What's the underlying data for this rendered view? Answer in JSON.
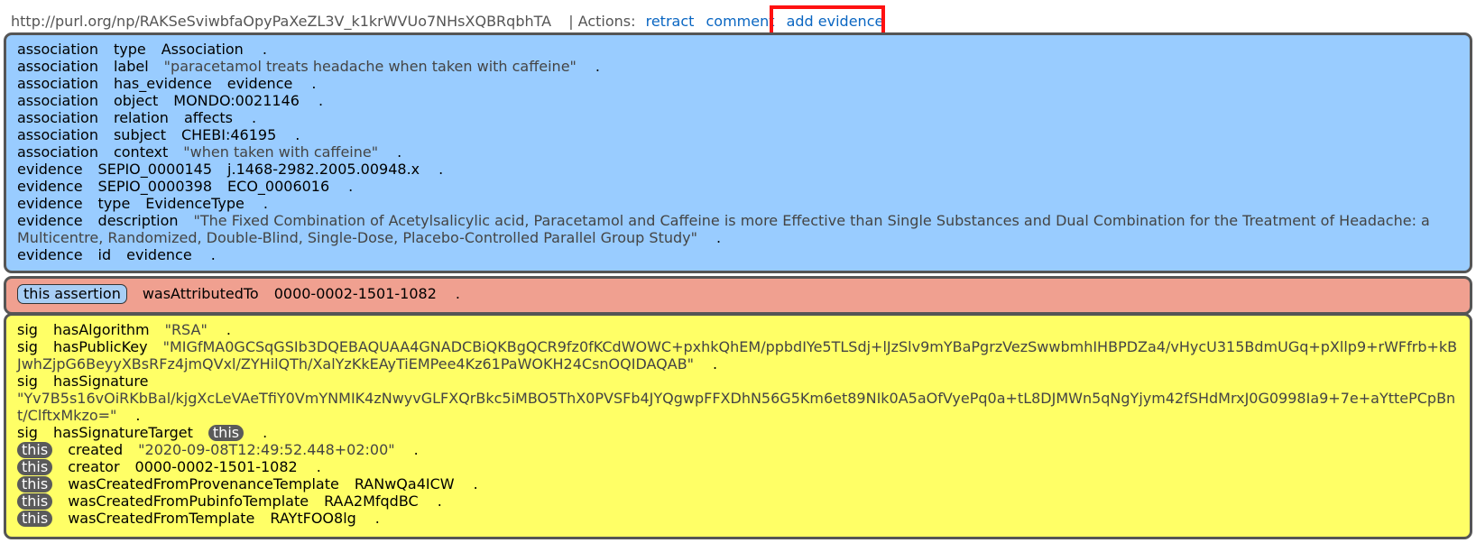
{
  "header": {
    "uri": "http://purl.org/np/RAKSeSviwbfaOpyPaXeZL3V_k1krWVUo7NHsXQBRqbhTA",
    "actions_label": "| Actions:",
    "actions": [
      "retract",
      "comment",
      "add evidence"
    ]
  },
  "highlight_color": "#ff1111",
  "colors": {
    "assertion_bg": "#99ccff",
    "provenance_bg": "#f0a090",
    "pubinfo_bg": "#ffff66",
    "link": "#0a66c2"
  },
  "dot": ".",
  "assertion": [
    {
      "s": "association",
      "p": "type",
      "o": "Association"
    },
    {
      "s": "association",
      "p": "label",
      "o": "\"paracetamol treats headache when taken with caffeine\""
    },
    {
      "s": "association",
      "p": "has_evidence",
      "o": "evidence"
    },
    {
      "s": "association",
      "p": "object",
      "o": "MONDO:0021146"
    },
    {
      "s": "association",
      "p": "relation",
      "o": "affects"
    },
    {
      "s": "association",
      "p": "subject",
      "o": "CHEBI:46195"
    },
    {
      "s": "association",
      "p": "context",
      "o": "\"when taken with caffeine\""
    },
    {
      "s": "evidence",
      "p": "SEPIO_0000145",
      "o": "j.1468-2982.2005.00948.x"
    },
    {
      "s": "evidence",
      "p": "SEPIO_0000398",
      "o": "ECO_0006016"
    },
    {
      "s": "evidence",
      "p": "type",
      "o": "EvidenceType"
    },
    {
      "s": "evidence",
      "p": "description",
      "o": "\"The Fixed Combination of Acetylsalicylic acid, Paracetamol and Caffeine is more Effective than Single Substances and Dual Combination for the Treatment of Headache: a Multicentre, Randomized, Double-Blind, Single-Dose, Placebo-Controlled Parallel Group Study\""
    },
    {
      "s": "evidence",
      "p": "id",
      "o": "evidence"
    }
  ],
  "provenance": {
    "s": "this assertion",
    "p": "wasAttributedTo",
    "o": "0000-0002-1501-1082"
  },
  "pubinfo": {
    "sig_alg": {
      "s": "sig",
      "p": "hasAlgorithm",
      "o": "\"RSA\""
    },
    "sig_key": {
      "s": "sig",
      "p": "hasPublicKey",
      "o": "\"MIGfMA0GCSqGSIb3DQEBAQUAA4GNADCBiQKBgQCR9fz0fKCdWOWC+pxhkQhEM/ppbdIYe5TLSdj+lJzSlv9mYBaPgrzVezSwwbmhIHBPDZa4/vHycU315BdmUGq+pXllp9+rWFfrb+kBJwhZjpG6BeyyXBsRFz4jmQVxl/ZYHilQTh/XalYzKkEAyTiEMPee4Kz61PaWOKH24CsnOQIDAQAB\""
    },
    "sig_signature": {
      "s": "sig",
      "p": "hasSignature",
      "o": "\"Yv7B5s16vOiRKbBal/kjgXcLeVAeTfiY0VmYNMIK4zNwyvGLFXQrBkc5iMBO5ThX0PVSFb4JYQgwpFFXDhN56G5Km6et89NIk0A5aOfVyePq0a+tL8DJMWn5qNgYjym42fSHdMrxJ0G0998Ia9+7e+aYttePCpBnt/ClftxMkzo=\""
    },
    "sig_target": {
      "s": "sig",
      "p": "hasSignatureTarget",
      "o": "this"
    },
    "this_triples": [
      {
        "s": "this",
        "p": "created",
        "o": "\"2020-09-08T12:49:52.448+02:00\""
      },
      {
        "s": "this",
        "p": "creator",
        "o": "0000-0002-1501-1082"
      },
      {
        "s": "this",
        "p": "wasCreatedFromProvenanceTemplate",
        "o": "RANwQa4ICW"
      },
      {
        "s": "this",
        "p": "wasCreatedFromPubinfoTemplate",
        "o": "RAA2MfqdBC"
      },
      {
        "s": "this",
        "p": "wasCreatedFromTemplate",
        "o": "RAYtFOO8lg"
      }
    ]
  }
}
